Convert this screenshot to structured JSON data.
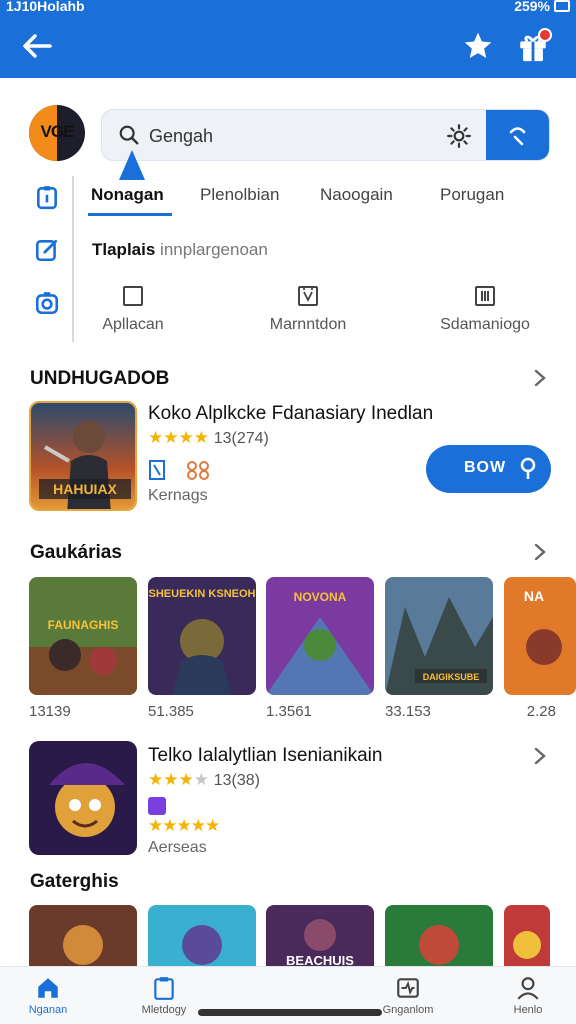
{
  "status_bar": {
    "left": "1J10Holahb",
    "right": "259%"
  },
  "header": {
    "back_icon": "arrow-left-icon",
    "favorite_icon": "star-icon",
    "gift_icon": "gift-icon"
  },
  "logo": {
    "text": "VGE"
  },
  "search": {
    "value": "Gengah",
    "placeholder": "Gengah"
  },
  "tabs": [
    {
      "label": "Nonagan",
      "active": true
    },
    {
      "label": "Plenolbian"
    },
    {
      "label": "Naoogain"
    },
    {
      "label": "Porugan"
    }
  ],
  "subtitle": {
    "bold": "Tlaplais",
    "light": "innplargenoan"
  },
  "categories": [
    {
      "label": "Apllacan",
      "icon": "square-icon"
    },
    {
      "label": "Marnntdon",
      "icon": "document-icon"
    },
    {
      "label": "Sdamaniogo",
      "icon": "grid-icon"
    }
  ],
  "section_1": {
    "title": "UNDHUGADOB"
  },
  "featured": {
    "title": "Koko Alplkcke Fdanasiary Inedlan",
    "rating_count": "13(274)",
    "subtitle": "Kernags",
    "button_label": "BOW",
    "thumb_label": "HAHUIAX"
  },
  "section_2": {
    "title": "Gaukárias"
  },
  "carousel": [
    {
      "price": "13139",
      "label": "FAUNAGHIS"
    },
    {
      "price": "51.385",
      "label": "SHEUEKIN KSNEOH"
    },
    {
      "price": "1.3561",
      "label": "NOVONA"
    },
    {
      "price": "33.153",
      "label": "DAIGIKSUBE"
    },
    {
      "price": "2.28",
      "label": "NA"
    }
  ],
  "featured_2": {
    "title": "Telko Ialalytlian Isenianikain",
    "rating_count": "13(38)",
    "subtitle": "Aerseas"
  },
  "section_3": {
    "title": "Gaterghis"
  },
  "bottom_row": [
    {
      "label": ""
    },
    {
      "label": ""
    },
    {
      "label": "BEACHUIS"
    },
    {
      "label": ""
    },
    {
      "label": ""
    }
  ],
  "bottom_nav": [
    {
      "label": "Nganan",
      "icon": "home-icon",
      "active": true
    },
    {
      "label": "Mletdogy",
      "icon": "clipboard-icon"
    },
    {
      "label": "Gnganlom",
      "icon": "activity-icon"
    },
    {
      "label": "Henlo",
      "icon": "person-icon"
    }
  ],
  "colors": {
    "primary": "#1a6fd8",
    "star": "#f5b400",
    "background": "#ffffff"
  }
}
